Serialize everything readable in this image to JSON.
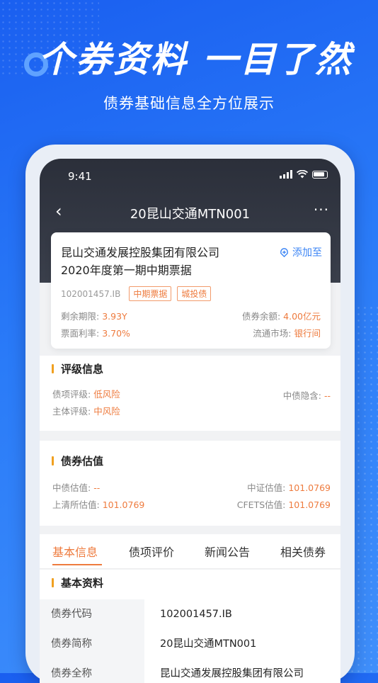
{
  "hero": {
    "title": "个券资料 一目了然",
    "subtitle": "债券基础信息全方位展示"
  },
  "status_bar": {
    "time": "9:41"
  },
  "nav": {
    "title": "20昆山交通MTN001",
    "back_icon": "chevron-left-icon",
    "more_icon": "more-icon"
  },
  "bond": {
    "name_line1": "昆山交通发展控股集团有限公司",
    "name_line2": "2020年度第一期中期票据",
    "add_label": "添加至",
    "code": "102001457.IB",
    "tags": [
      "中期票据",
      "城投债"
    ],
    "remaining_term_label": "剩余期限:",
    "remaining_term": "3.93Y",
    "coupon_label": "票面利率:",
    "coupon": "3.70%",
    "balance_label": "债券余额:",
    "balance": "4.00亿元",
    "market_label": "流通市场:",
    "market": "银行间"
  },
  "rating": {
    "title": "评级信息",
    "debt_rating_label": "债项评级:",
    "debt_rating": "低风险",
    "issuer_rating_label": "主体评级:",
    "issuer_rating": "中风险",
    "implied_label": "中债隐含:",
    "implied": "--"
  },
  "valuation": {
    "title": "债券估值",
    "cb_label": "中债估值:",
    "cb": "--",
    "cs_label": "中证估值:",
    "cs": "101.0769",
    "sh_label": "上清所估值:",
    "sh": "101.0769",
    "cfets_label": "CFETS估值:",
    "cfets": "101.0769"
  },
  "tabs": [
    "基本信息",
    "债项评价",
    "新闻公告",
    "相关债券"
  ],
  "basic": {
    "title": "基本资料",
    "rows": [
      {
        "key": "债券代码",
        "value": "102001457.IB"
      },
      {
        "key": "债券简称",
        "value": "20昆山交通MTN001"
      },
      {
        "key": "债券全称",
        "value": "昆山交通发展控股集团有限公司"
      }
    ]
  },
  "colors": {
    "accent": "#ee7b3e",
    "brand_blue": "#2a7bf8",
    "link_blue": "#3d86f5"
  }
}
